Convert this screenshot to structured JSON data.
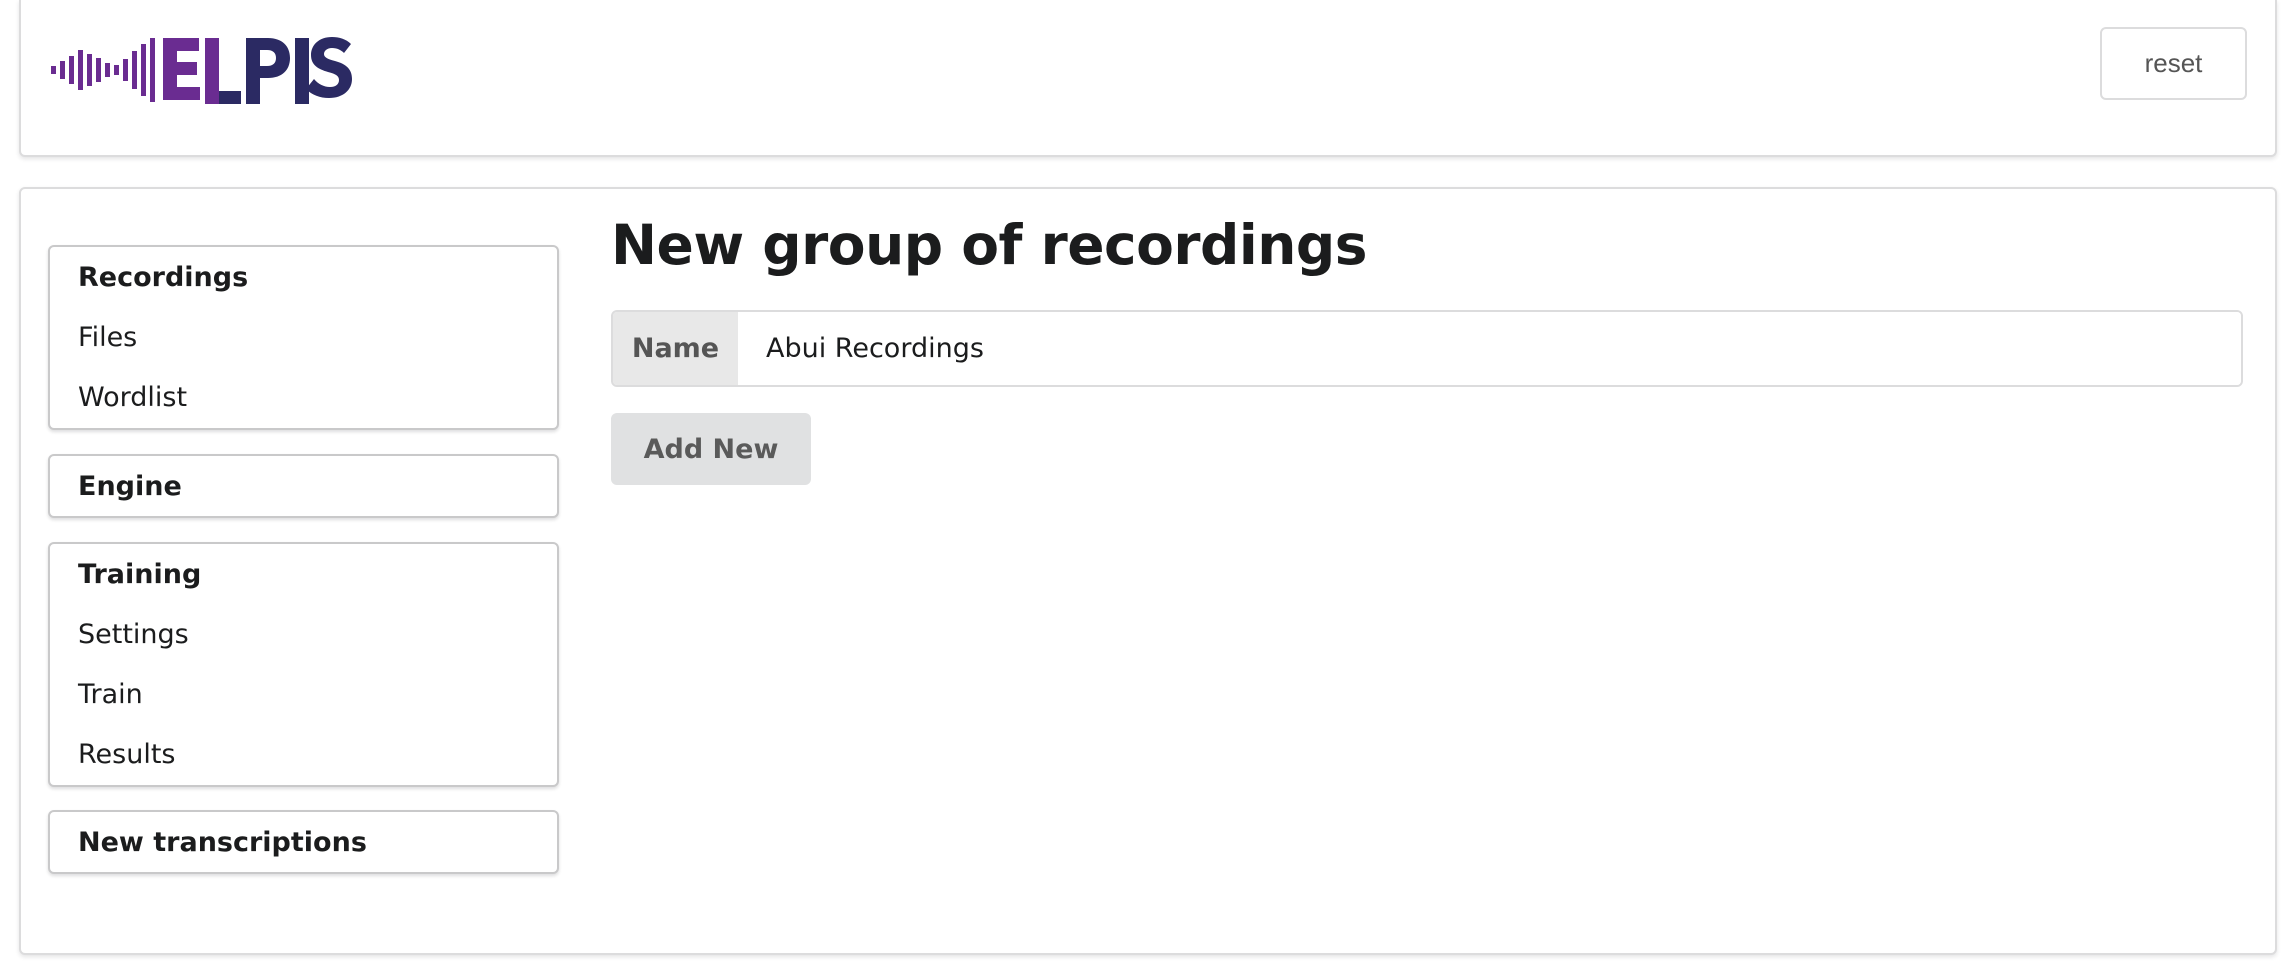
{
  "header": {
    "logo_text": "ELPIS",
    "reset_label": "reset"
  },
  "sidebar": {
    "groups": [
      {
        "header": "Recordings",
        "items": [
          {
            "label": "Files"
          },
          {
            "label": "Wordlist"
          }
        ]
      },
      {
        "header": "Engine",
        "items": []
      },
      {
        "header": "Training",
        "items": [
          {
            "label": "Settings"
          },
          {
            "label": "Train"
          },
          {
            "label": "Results"
          }
        ]
      },
      {
        "header": "New transcriptions",
        "items": []
      }
    ]
  },
  "main": {
    "title": "New group of recordings",
    "name_field": {
      "label": "Name",
      "value": "Abui Recordings"
    },
    "add_new_label": "Add New"
  },
  "colors": {
    "logo_purple": "#6a2c91",
    "logo_navy": "#2b2a63",
    "button_gray": "#e0e1e2"
  }
}
